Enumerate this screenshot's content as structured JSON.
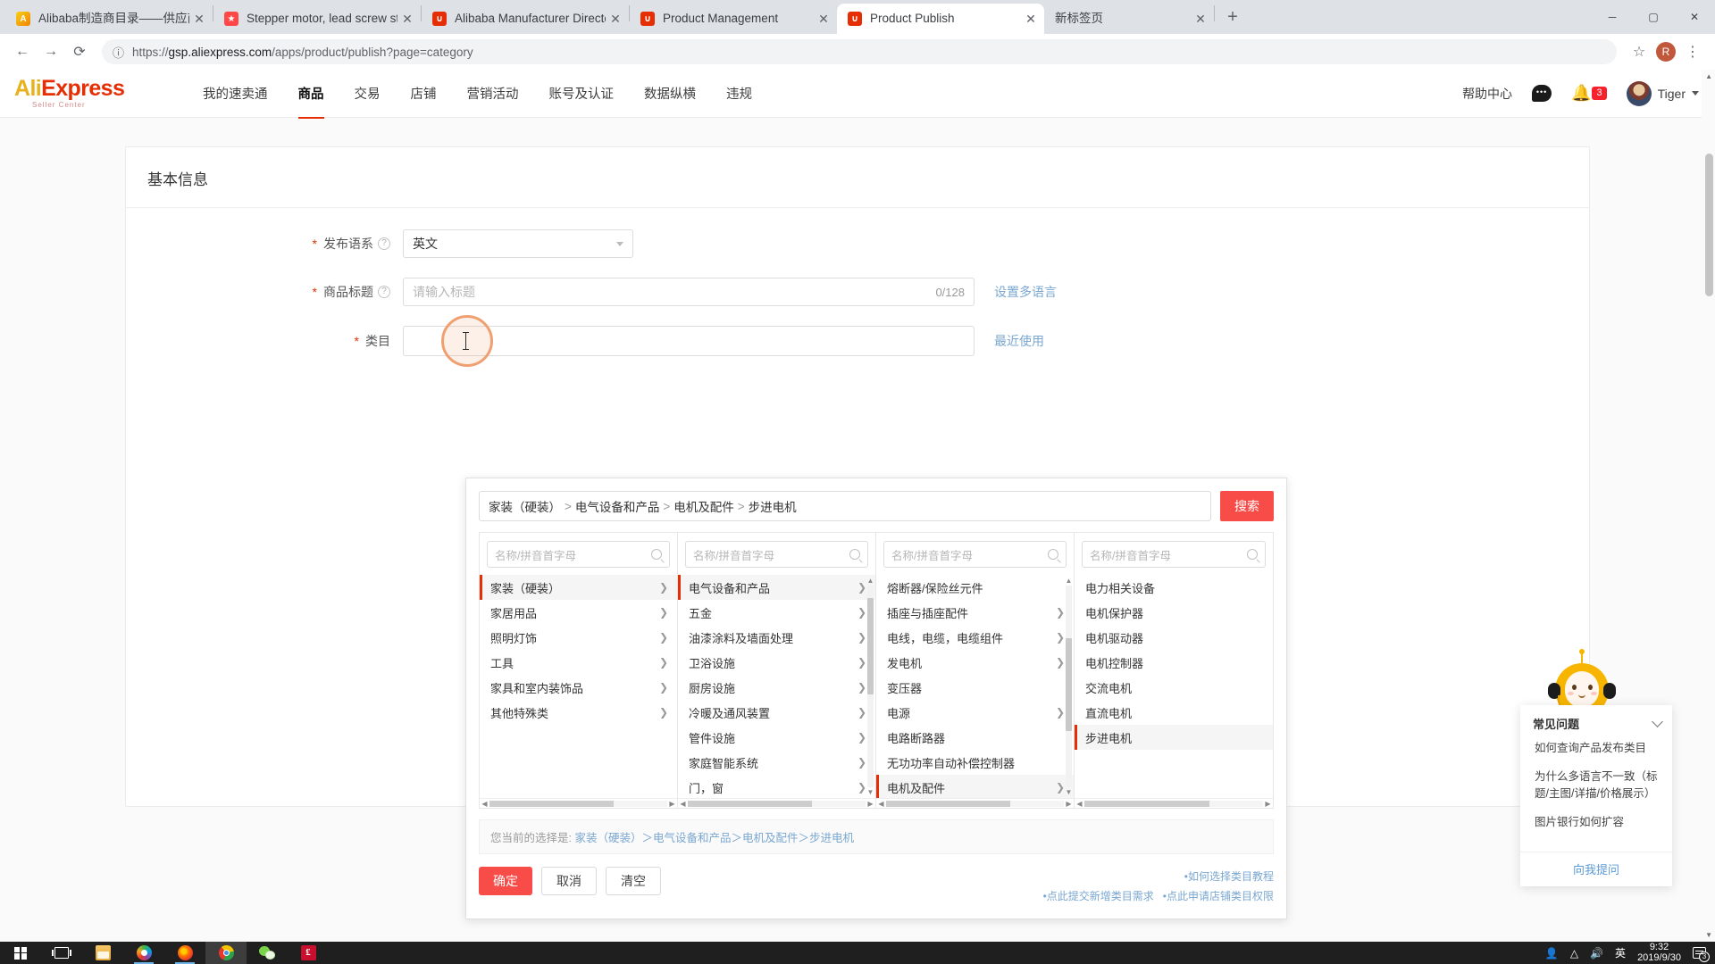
{
  "browser": {
    "tabs": [
      {
        "title": "Alibaba制造商目录——供应商、",
        "favicon": "alibaba-icon",
        "active": false
      },
      {
        "title": "Stepper motor, lead screw ste",
        "favicon": "alibaba-round-icon",
        "active": false
      },
      {
        "title": "Alibaba Manufacturer Director",
        "favicon": "aliexpress-icon",
        "active": false
      },
      {
        "title": "Product Management",
        "favicon": "aliexpress-icon",
        "active": false
      },
      {
        "title": "Product Publish",
        "favicon": "aliexpress-icon",
        "active": true
      },
      {
        "title": "新标签页",
        "favicon": "none",
        "active": false
      }
    ],
    "new_tab_label": "+",
    "close_label": "✕",
    "window": {
      "minimize": "─",
      "maximize": "▢",
      "close": "✕"
    },
    "nav": {
      "back": "←",
      "forward": "→",
      "reload": "⟳",
      "star": "☆",
      "menu": "⋮"
    },
    "url_scheme": "https://",
    "url_host": "gsp.aliexpress.com",
    "url_path": "/apps/product/publish?page=category",
    "profile_initial": "R"
  },
  "site": {
    "logo_ali": "Ali",
    "logo_express": "Express",
    "logo_sub": "Seller Center",
    "nav_items": [
      {
        "label": "我的速卖通",
        "active": false
      },
      {
        "label": "商品",
        "active": true
      },
      {
        "label": "交易",
        "active": false
      },
      {
        "label": "店铺",
        "active": false
      },
      {
        "label": "营销活动",
        "active": false
      },
      {
        "label": "账号及认证",
        "active": false
      },
      {
        "label": "数据纵横",
        "active": false
      },
      {
        "label": "违规",
        "active": false
      }
    ],
    "help_center": "帮助中心",
    "notification_count": "3",
    "user_name": "Tiger"
  },
  "form": {
    "card_title": "基本信息",
    "language": {
      "label": "发布语系",
      "value": "英文",
      "required": "*"
    },
    "title": {
      "label": "商品标题",
      "placeholder": "请输入标题",
      "counter": "0/128",
      "link": "设置多语言",
      "required": "*"
    },
    "category": {
      "label": "类目",
      "value": "",
      "link": "最近使用",
      "required": "*"
    }
  },
  "picker": {
    "search_value_parts": [
      "家装（硬装）",
      "电气设备和产品",
      "电机及配件",
      "步进电机"
    ],
    "search_button": "搜索",
    "column_search_placeholder": "名称/拼音首字母",
    "columns": [
      {
        "items": [
          {
            "label": "家装（硬装）",
            "has_children": true,
            "selected": true
          },
          {
            "label": "家居用品",
            "has_children": true,
            "selected": false
          },
          {
            "label": "照明灯饰",
            "has_children": true,
            "selected": false
          },
          {
            "label": "工具",
            "has_children": true,
            "selected": false
          },
          {
            "label": "家具和室内装饰品",
            "has_children": true,
            "selected": false
          },
          {
            "label": "其他特殊类",
            "has_children": true,
            "selected": false
          }
        ],
        "scroll": false
      },
      {
        "items": [
          {
            "label": "电气设备和产品",
            "has_children": true,
            "selected": true
          },
          {
            "label": "五金",
            "has_children": true,
            "selected": false
          },
          {
            "label": "油漆涂料及墙面处理",
            "has_children": true,
            "selected": false
          },
          {
            "label": "卫浴设施",
            "has_children": true,
            "selected": false
          },
          {
            "label": "厨房设施",
            "has_children": true,
            "selected": false
          },
          {
            "label": "冷暖及通风装置",
            "has_children": true,
            "selected": false
          },
          {
            "label": "管件设施",
            "has_children": true,
            "selected": false
          },
          {
            "label": "家庭智能系统",
            "has_children": true,
            "selected": false
          },
          {
            "label": "门，窗",
            "has_children": true,
            "selected": false
          }
        ],
        "scroll": true
      },
      {
        "items": [
          {
            "label": "熔断器/保险丝元件",
            "has_children": false,
            "selected": false
          },
          {
            "label": "插座与插座配件",
            "has_children": true,
            "selected": false
          },
          {
            "label": "电线，电缆，电缆组件",
            "has_children": true,
            "selected": false
          },
          {
            "label": "发电机",
            "has_children": true,
            "selected": false
          },
          {
            "label": "变压器",
            "has_children": false,
            "selected": false
          },
          {
            "label": "电源",
            "has_children": true,
            "selected": false
          },
          {
            "label": "电路断路器",
            "has_children": false,
            "selected": false
          },
          {
            "label": "无功功率自动补偿控制器",
            "has_children": false,
            "selected": false
          },
          {
            "label": "电机及配件",
            "has_children": true,
            "selected": true
          }
        ],
        "scroll": true
      },
      {
        "items": [
          {
            "label": "电力相关设备",
            "has_children": false,
            "selected": false
          },
          {
            "label": "电机保护器",
            "has_children": false,
            "selected": false
          },
          {
            "label": "电机驱动器",
            "has_children": false,
            "selected": false
          },
          {
            "label": "电机控制器",
            "has_children": false,
            "selected": false
          },
          {
            "label": "交流电机",
            "has_children": false,
            "selected": false
          },
          {
            "label": "直流电机",
            "has_children": false,
            "selected": false
          },
          {
            "label": "步进电机",
            "has_children": false,
            "selected": true
          }
        ],
        "scroll": false
      }
    ],
    "selected_prefix": "您当前的选择是:",
    "selected_path": "家装（硬装）＞电气设备和产品＞电机及配件＞步进电机",
    "buttons": {
      "confirm": "确定",
      "cancel": "取消",
      "clear": "清空"
    },
    "help_links": [
      "如何选择类目教程",
      "点此提交新增类目需求",
      "点此申请店铺类目权限"
    ]
  },
  "faq": {
    "title": "常见问题",
    "items": [
      "如何查询产品发布类目",
      "为什么多语言不一致（标题/主图/详描/价格展示）",
      "图片银行如何扩容"
    ],
    "ask_button": "向我提问"
  },
  "taskbar": {
    "apps": [
      {
        "name": "task-view",
        "icon": "task-view-icon",
        "active": false,
        "running": false
      },
      {
        "name": "file-explorer",
        "icon": "folder-icon",
        "active": false,
        "running": false
      },
      {
        "name": "photos",
        "icon": "photos-icon",
        "active": false,
        "running": true
      },
      {
        "name": "firefox",
        "icon": "firefox-icon",
        "active": false,
        "running": true
      },
      {
        "name": "chrome",
        "icon": "chrome-icon",
        "active": true,
        "running": true
      },
      {
        "name": "wechat",
        "icon": "wechat-icon",
        "active": false,
        "running": false
      },
      {
        "name": "adobe-reader",
        "icon": "pdf-icon",
        "active": false,
        "running": false
      }
    ],
    "tray": {
      "ime": "英",
      "time": "9:32",
      "date": "2019/9/30",
      "notification_count": "3"
    }
  },
  "colors": {
    "accent": "#e62e04",
    "button_red": "#f74c48",
    "link_blue": "#7aa7d1",
    "badge_red": "#f5222d",
    "mascot_yellow": "#f7b500"
  }
}
